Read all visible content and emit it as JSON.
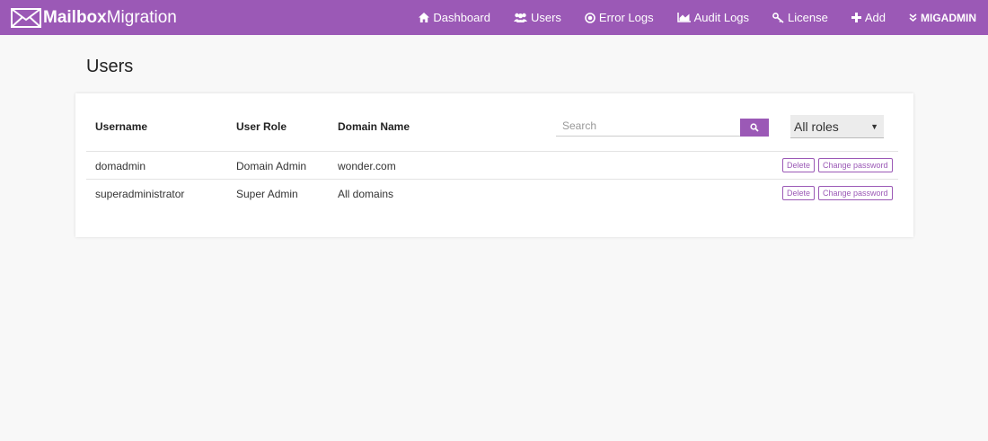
{
  "header": {
    "brand_bold": "Mailbox",
    "brand_rest": "Migration",
    "nav": {
      "dashboard": "Dashboard",
      "users": "Users",
      "error_logs": "Error Logs",
      "audit_logs": "Audit Logs",
      "license": "License",
      "add": "Add",
      "account": "MIGADMIN"
    }
  },
  "page": {
    "title": "Users"
  },
  "table": {
    "columns": {
      "username": "Username",
      "role": "User Role",
      "domain": "Domain Name"
    },
    "search_placeholder": "Search",
    "role_filter": "All roles",
    "rows": [
      {
        "username": "domadmin",
        "role": "Domain Admin",
        "domain": "wonder.com",
        "delete": "Delete",
        "change_password": "Change password"
      },
      {
        "username": "superadministrator",
        "role": "Super Admin",
        "domain": "All domains",
        "delete": "Delete",
        "change_password": "Change password"
      }
    ]
  },
  "colors": {
    "accent": "#9b59b6",
    "background": "#f8f8f8",
    "card": "#ffffff"
  }
}
